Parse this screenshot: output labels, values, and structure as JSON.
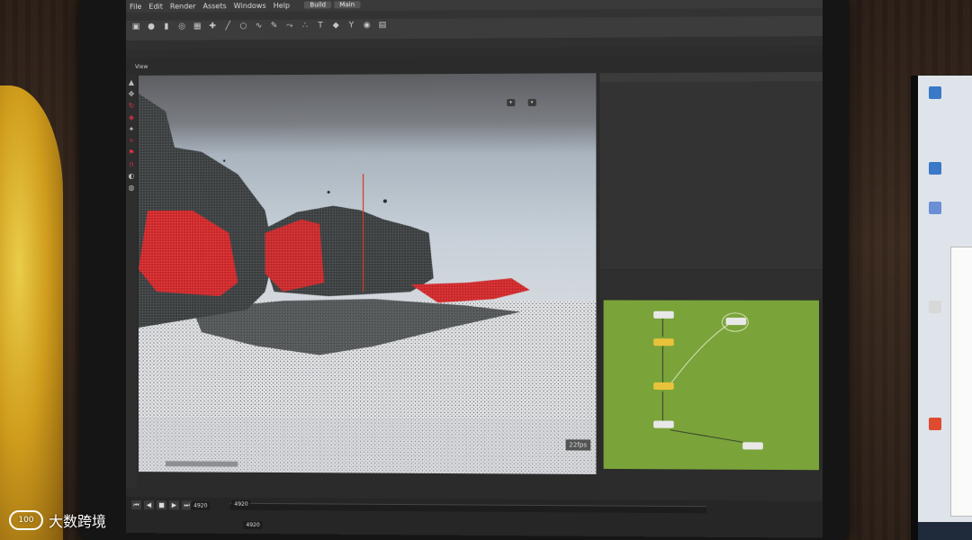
{
  "menubar": {
    "items": [
      "File",
      "Edit",
      "Render",
      "Assets",
      "Windows",
      "Help"
    ],
    "desks": [
      "Build",
      "Main"
    ]
  },
  "toolbar": {
    "frame_current": "4920",
    "frame_start": "4920",
    "frame_display": "4920"
  },
  "viewport": {
    "label": "View",
    "fps": "22fps"
  },
  "watermark": {
    "logo_text": "100",
    "text": "大数跨境"
  },
  "colors": {
    "network_bg": "#7aa33a",
    "node_selected": "#e8c23a",
    "accent_red": "#cc2a2a"
  }
}
